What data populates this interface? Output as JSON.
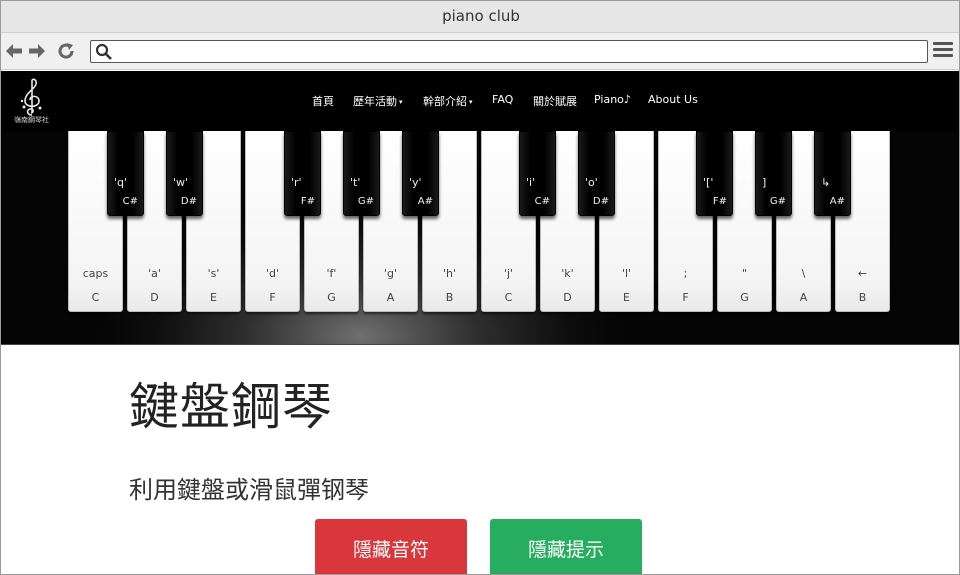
{
  "window": {
    "title": "piano club"
  },
  "toolbar": {
    "url": "",
    "url_placeholder": ""
  },
  "navbar": {
    "logo_text": "嶺南鋼琴社",
    "items": [
      {
        "label": "首頁",
        "caret": ""
      },
      {
        "label": "歷年活動",
        "caret": "▾"
      },
      {
        "label": "幹部介紹",
        "caret": "▾"
      },
      {
        "label": "FAQ",
        "caret": ""
      },
      {
        "label": "關於賦展",
        "caret": ""
      },
      {
        "label": "Piano♪",
        "caret": ""
      },
      {
        "label": "About Us",
        "caret": ""
      }
    ]
  },
  "piano": {
    "white_keys": [
      {
        "hint": "caps",
        "note": "C"
      },
      {
        "hint": "'a'",
        "note": "D"
      },
      {
        "hint": "'s'",
        "note": "E"
      },
      {
        "hint": "'d'",
        "note": "F"
      },
      {
        "hint": "'f'",
        "note": "G"
      },
      {
        "hint": "'g'",
        "note": "A"
      },
      {
        "hint": "'h'",
        "note": "B"
      },
      {
        "hint": "'j'",
        "note": "C"
      },
      {
        "hint": "'k'",
        "note": "D"
      },
      {
        "hint": "'l'",
        "note": "E"
      },
      {
        "hint": ";",
        "note": "F"
      },
      {
        "hint": "\"",
        "note": "G"
      },
      {
        "hint": "\\",
        "note": "A"
      },
      {
        "hint": "←",
        "note": "B"
      }
    ],
    "black_keys": [
      {
        "hint": "'q'",
        "note": "C#"
      },
      {
        "hint": "'w'",
        "note": "D#"
      },
      {
        "hint": "'r'",
        "note": "F#"
      },
      {
        "hint": "'t'",
        "note": "G#"
      },
      {
        "hint": "'y'",
        "note": "A#"
      },
      {
        "hint": "'i'",
        "note": "C#"
      },
      {
        "hint": "'o'",
        "note": "D#"
      },
      {
        "hint": "'['",
        "note": "F#"
      },
      {
        "hint": "]",
        "note": "G#"
      },
      {
        "hint": "↳",
        "note": "A#"
      }
    ]
  },
  "content": {
    "title": "鍵盤鋼琴",
    "subtitle": "利用鍵盤或滑鼠彈钢琴",
    "hide_notes_button": "隱藏音符",
    "hide_hints_button": "隱藏提示"
  },
  "colors": {
    "hide_notes": "#d9373c",
    "hide_hints": "#27ad5f",
    "navbar": "#000000"
  }
}
